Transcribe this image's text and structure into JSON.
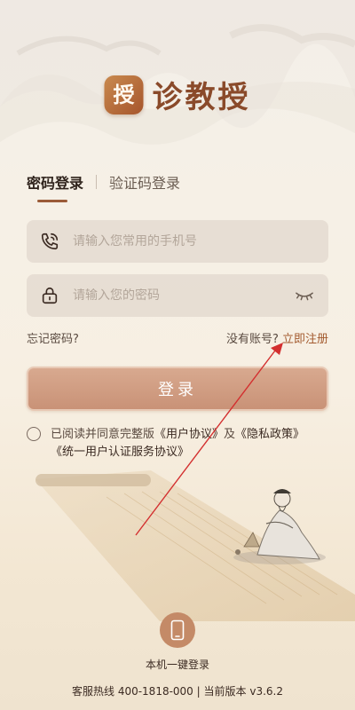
{
  "app": {
    "name": "诊教授",
    "logo_glyph": "授"
  },
  "tabs": {
    "password_login": "密码登录",
    "code_login": "验证码登录"
  },
  "form": {
    "phone_placeholder": "请输入您常用的手机号",
    "password_placeholder": "请输入您的密码",
    "forgot_password": "忘记密码?",
    "no_account": "没有账号?",
    "register": "立即注册",
    "login_button": "登录"
  },
  "agreement": {
    "prefix": "已阅读并同意完整版",
    "user_agreement": "《用户协议》",
    "and": "及",
    "privacy_policy": "《隐私政策》",
    "unified_agreement": "《统一用户认证服务协议》"
  },
  "one_key_login": {
    "label": "本机一键登录",
    "icon": "smartphone-icon"
  },
  "footer": {
    "hotline_label": "客服热线",
    "hotline": "400-1818-000",
    "separator": "|",
    "version_label": "当前版本",
    "version": "v3.6.2"
  },
  "colors": {
    "brand": "#8a4a2a",
    "accent": "#a35a2e",
    "button": "#c99277",
    "annotation_arrow": "#d32f2f"
  }
}
